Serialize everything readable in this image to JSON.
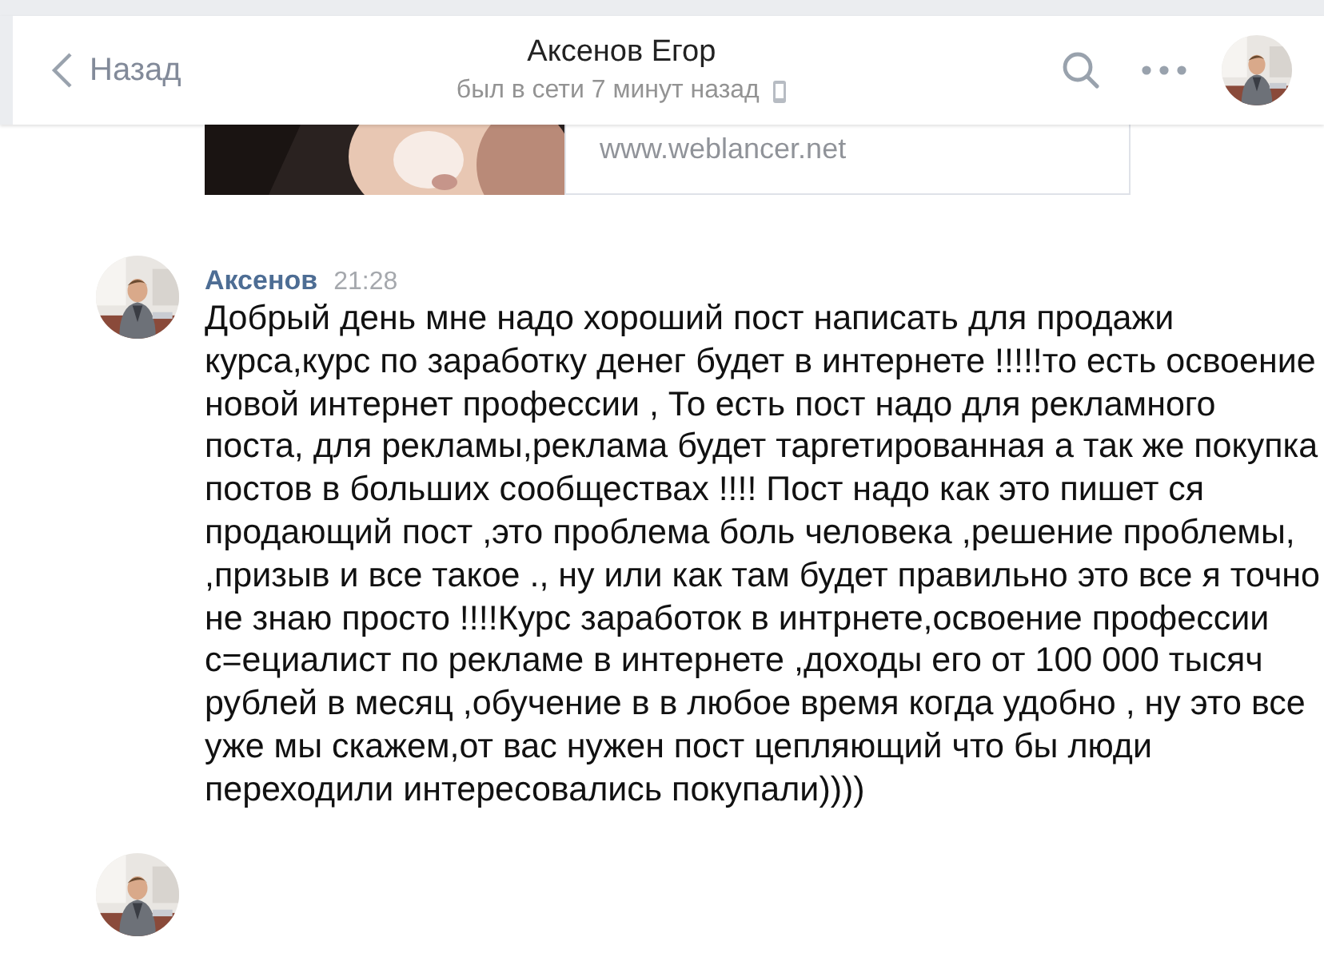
{
  "header": {
    "back": "Назад",
    "title": "Аксенов Егор",
    "status": "был в сети 7 минут назад"
  },
  "link_card": {
    "url": "www.weblancer.net"
  },
  "messages": [
    {
      "author": "Аксенов",
      "time": "21:28",
      "text": "Добрый день мне надо хороший пост написать для продажи курса,курс по заработку денег будет в интернете !!!!!то есть освоение новой интернет профессии , То есть пост надо для рекламного поста, для рекламы,реклама будет таргетированная а так же покупка постов в больших сообществах !!!! Пост надо как это пишет ся продающий пост ,это проблема боль человека ,решение проблемы, ,призыв и все такое ., ну или как там будет правильно это все я точно не знаю просто !!!!Курс заработок в интрнете,освоение профессии с=ециалист по рекламе в интернете ,доходы его от 100 000 тысяч рублей в месяц ,обучение в в любое время когда удобно , ну это все уже мы скажем,от вас нужен пост цепляющий что бы люди переходили интересовались покупали))))"
    }
  ]
}
